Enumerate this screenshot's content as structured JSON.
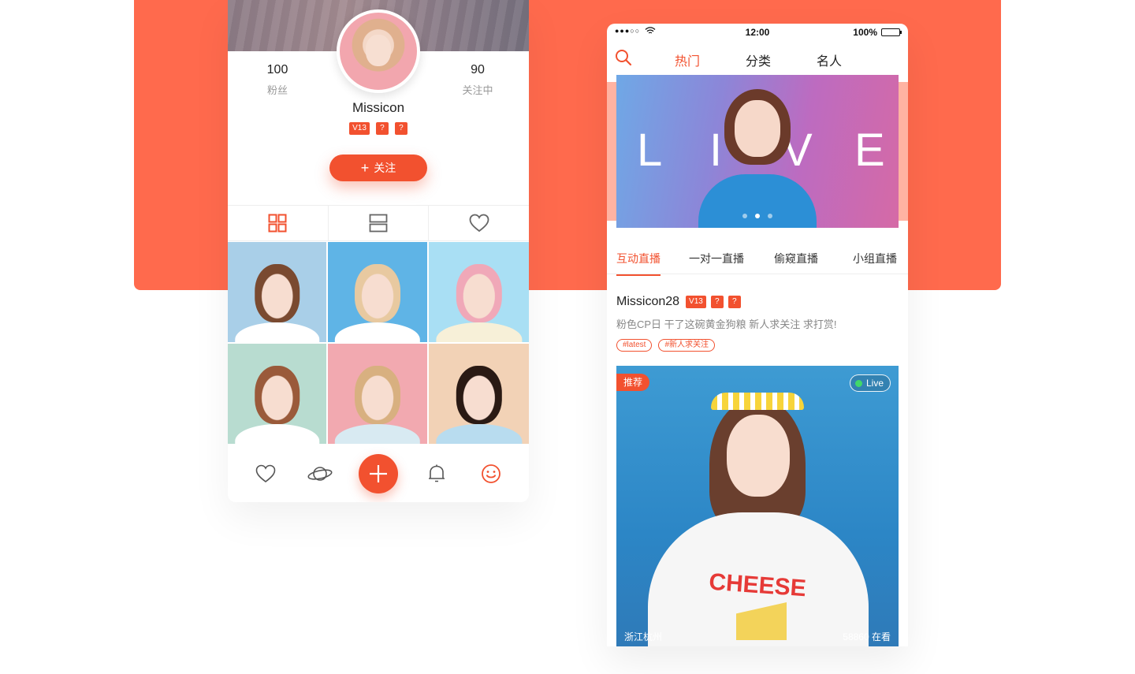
{
  "profile": {
    "fans_count": "100",
    "fans_label": "粉丝",
    "following_count": "90",
    "following_label": "关注中",
    "username": "Missicon",
    "badges": [
      "V13",
      "?",
      "?"
    ],
    "follow_button": "关注",
    "view_tabs": [
      "grid-icon",
      "list-icon",
      "heart-icon"
    ],
    "photos": [
      {
        "bg": "#a9cfe8",
        "hair": "#7a4a30",
        "shirt": "#ffffff"
      },
      {
        "bg": "#5fb4e6",
        "hair": "#e8c9a0",
        "shirt": "#ffffff"
      },
      {
        "bg": "#a9dff4",
        "hair": "#f0a8b8",
        "shirt": "#f7f0d8"
      },
      {
        "bg": "#b8dcd0",
        "hair": "#9a5a3a",
        "shirt": "#ffffff"
      },
      {
        "bg": "#f2a9b0",
        "hair": "#d8b080",
        "shirt": "#d8eaf2"
      },
      {
        "bg": "#f2d2b6",
        "hair": "#2a1a14",
        "shirt": "#b8dcef"
      }
    ],
    "bottom_nav": [
      "heart-icon",
      "planet-icon",
      "add-icon",
      "bell-icon",
      "smile-icon"
    ]
  },
  "feed": {
    "status": {
      "time": "12:00",
      "battery": "100%",
      "battery_level": 1.0
    },
    "top_tabs": {
      "hot": "热门",
      "category": "分类",
      "celebrity": "名人"
    },
    "banner": {
      "letters": [
        "L",
        "I",
        "V",
        "E"
      ],
      "dot_count": 3,
      "active_dot": 1
    },
    "live_tabs": [
      "互动直播",
      "一对一直播",
      "偷窥直播",
      "小组直播"
    ],
    "post": {
      "username": "Missicon28",
      "badges": [
        "V13",
        "?",
        "?"
      ],
      "text": "粉色CP日 干了这碗黄金狗粮 新人求关注 求打赏!",
      "tags": [
        "#latest",
        "#新人求关注"
      ]
    },
    "live_card": {
      "recommend_label": "推荐",
      "live_label": "Live",
      "shirt_text": "CHEESE",
      "location": "浙江杭州",
      "viewers": "58860 在看"
    }
  },
  "colors": {
    "accent": "#f2512f",
    "band": "#ff6a4d",
    "live_dot": "#41d86a"
  }
}
